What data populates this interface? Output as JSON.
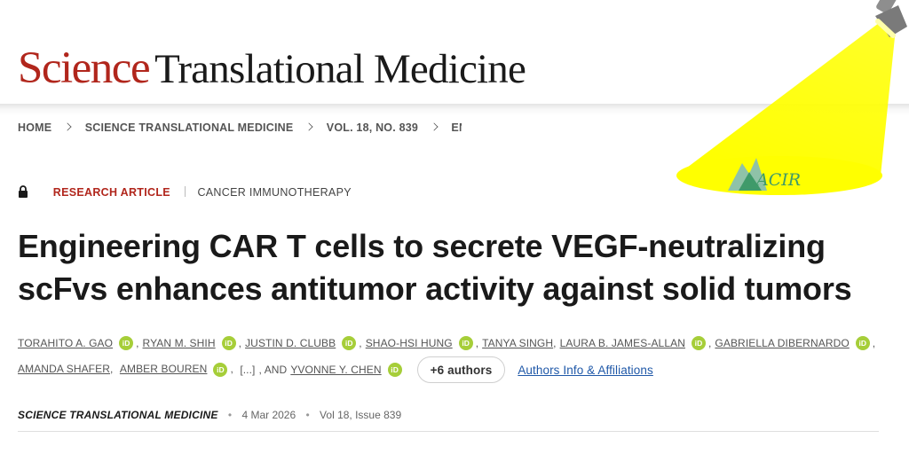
{
  "masthead": {
    "brand": "Science",
    "journal": "Translational Medicine"
  },
  "breadcrumb": {
    "items": [
      "HOME",
      "SCIENCE TRANSLATIONAL MEDICINE",
      "VOL. 18, NO. 839",
      "ENGINEERII"
    ]
  },
  "overlay": {
    "logo_text": "ACIR",
    "spot_color": "#ffff00"
  },
  "article": {
    "type": "RESEARCH ARTICLE",
    "subject": "CANCER IMMUNOTHERAPY",
    "title_line1": "Engineering CAR T cells to secrete VEGF-neutralizing",
    "title_line2": "scFvs enhances antitumor activity against solid tumors"
  },
  "authors": {
    "line1": [
      {
        "name": "TORAHITO A. GAO",
        "orcid": true
      },
      {
        "name": "RYAN M. SHIH",
        "orcid": true
      },
      {
        "name": "JUSTIN D. CLUBB",
        "orcid": true
      },
      {
        "name": "SHAO-HSI HUNG",
        "orcid": true
      },
      {
        "name": "TANYA SINGH",
        "orcid": false
      },
      {
        "name": "LAURA B. JAMES-ALLAN",
        "orcid": true
      },
      {
        "name": "GABRIELLA DIBERNARDO",
        "orcid": true
      }
    ],
    "line2": [
      {
        "name": "AMANDA SHAFER",
        "orcid": false
      },
      {
        "name": "AMBER BOUREN",
        "orcid": true
      }
    ],
    "ellipsis": "[...]",
    "and": ", AND",
    "last_author": "YVONNE Y. CHEN",
    "orcid_label": "iD",
    "more_button": "+6 authors",
    "affiliations_link": "Authors Info & Affiliations"
  },
  "citation": {
    "journal": "SCIENCE TRANSLATIONAL MEDICINE",
    "date": "4 Mar 2026",
    "volume": "Vol 18, Issue 839"
  },
  "colors": {
    "brand_red": "#b1261c",
    "orcid_green": "#a6ce39",
    "link_blue": "#1f58a8"
  },
  "icons": [
    "lock-icon",
    "chevron-right-icon",
    "orcid-icon",
    "spotlight-icon"
  ]
}
